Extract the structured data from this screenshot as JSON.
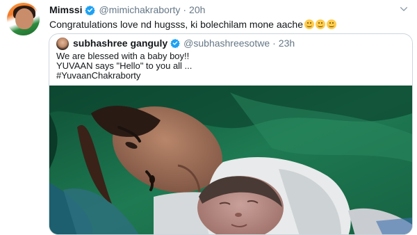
{
  "tweet": {
    "display_name": "Mimssi",
    "handle": "@mimichakraborty",
    "separator": "·",
    "time": "20h",
    "text": "Congratulations love nd hugsss, ki bolechilam mone aache",
    "emojis": [
      "hugging-face",
      "hugging-face",
      "hugging-face"
    ]
  },
  "quoted_tweet": {
    "display_name": "subhashree ganguly",
    "handle": "@subhashreesotwe",
    "separator": "·",
    "time": "23h",
    "lines": [
      "We are blessed with a baby boy!!",
      "YUVAAN  says \"Hello\" to you all ...",
      "#YuvaanChakraborty"
    ],
    "media": "photo"
  },
  "colors": {
    "verified": "#1da1f2",
    "secondary_text": "#657786",
    "border": "#ccd6dd",
    "emoji": "#ffcc4d"
  }
}
